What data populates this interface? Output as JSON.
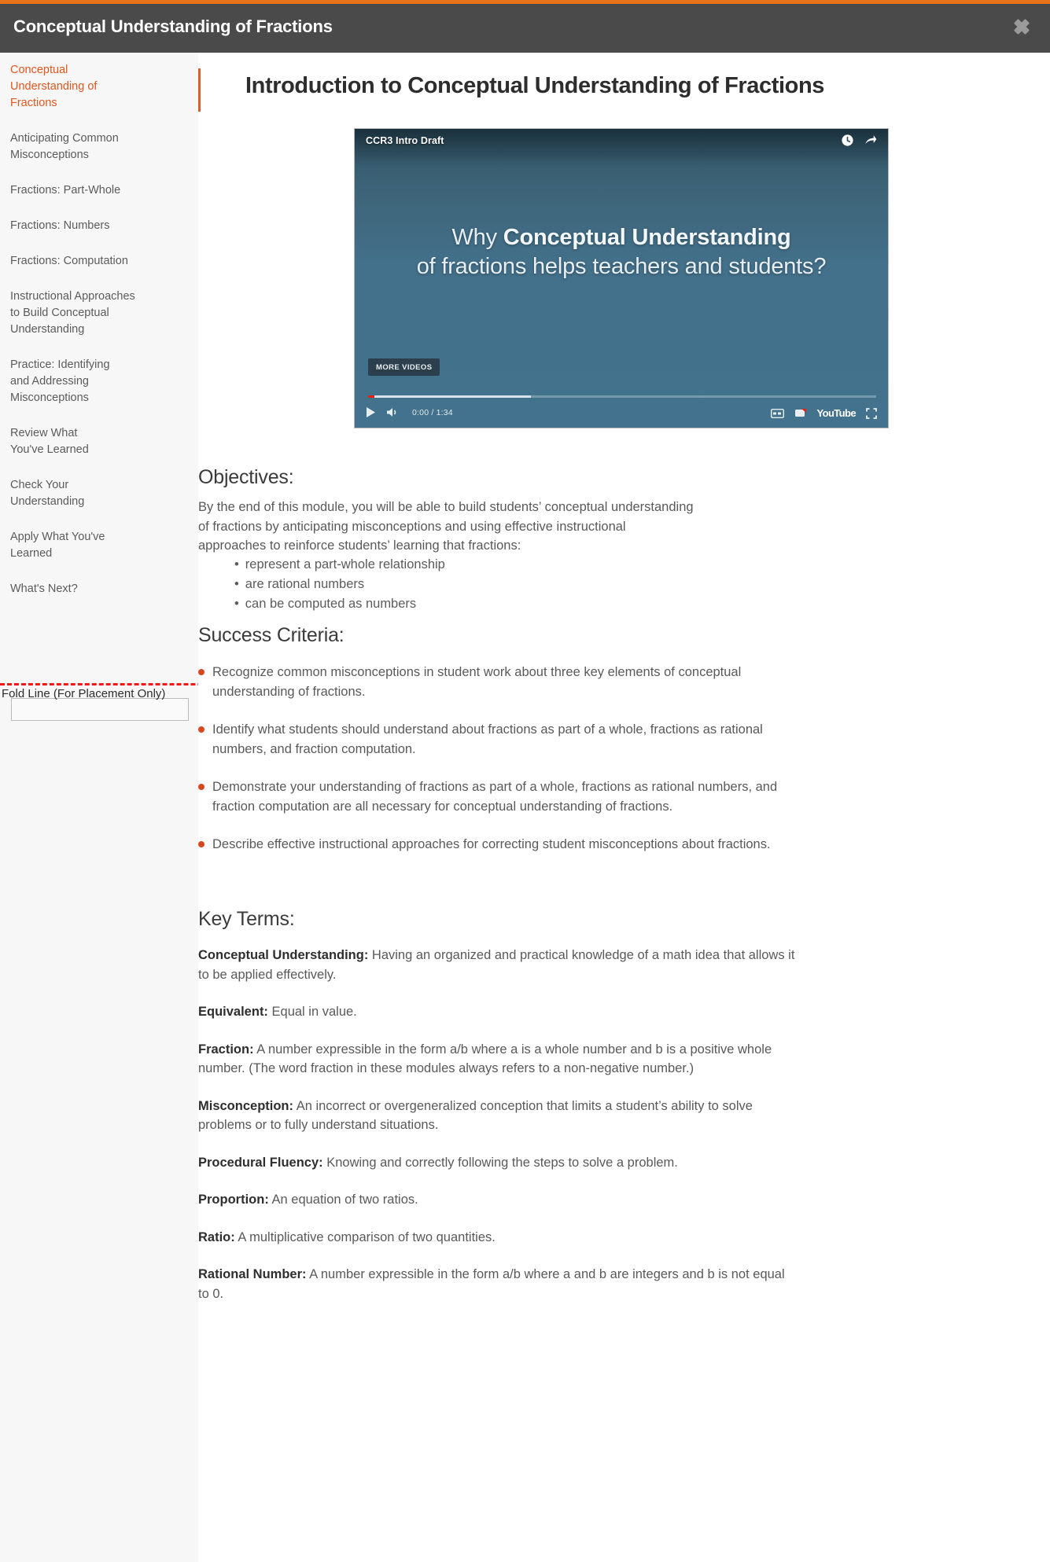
{
  "header": {
    "title": "Conceptual Understanding of Fractions",
    "close_label": "×",
    "accent_color": "#e8731d",
    "bar_color": "#4a4a4a"
  },
  "sidebar": {
    "items": [
      {
        "label": "Conceptual Understanding of Fractions",
        "active": true
      },
      {
        "label": "Anticipating Common Misconceptions",
        "active": false
      },
      {
        "label": "Fractions: Part-Whole",
        "active": false
      },
      {
        "label": "Fractions: Numbers",
        "active": false
      },
      {
        "label": "Fractions: Computation",
        "active": false
      },
      {
        "label": "Instructional Approaches to Build Conceptual Understanding",
        "active": false
      },
      {
        "label": "Practice: Identifying and Addressing Misconceptions",
        "active": false
      },
      {
        "label": "Review What You've Learned",
        "active": false
      },
      {
        "label": "Check Your Understanding",
        "active": false
      },
      {
        "label": "Apply What You've Learned",
        "active": false
      },
      {
        "label": "What's Next?",
        "active": false
      }
    ],
    "input_value": "",
    "input_placeholder": "",
    "active_color": "#e2561f"
  },
  "fold": {
    "label": "Fold Line (For Placement Only)",
    "color": "#f01818"
  },
  "main": {
    "page_title": "Introduction to Conceptual Understanding of Fractions",
    "video": {
      "name": "CCR3 Intro Draft",
      "headline_pre": "Why ",
      "headline_bold": "Conceptual Understanding",
      "headline_rest": "of fractions helps teachers and students?",
      "more_videos_label": "MORE VIDEOS",
      "current_time": "0:00",
      "duration": "1:34",
      "time_display": "0:00 / 1:34",
      "brand": "YouTube",
      "icons": {
        "watch_later": "clock-icon",
        "share": "share-icon",
        "play": "play-icon",
        "volume": "volume-icon",
        "captions": "captions-icon",
        "settings": "settings-icon",
        "fullscreen": "fullscreen-icon"
      }
    },
    "objectives": {
      "heading": "Objectives:",
      "intro": "By the end of this module, you will be able to build students’ conceptual understanding of fractions by anticipating misconceptions and using effective instructional approaches to reinforce students’ learning that fractions:",
      "bullets": [
        "represent a part-whole relationship",
        "are rational numbers",
        "can be computed as numbers"
      ]
    },
    "success_criteria": {
      "heading": "Success Criteria:",
      "items": [
        "Recognize common misconceptions in student work about three key elements of conceptual understanding of fractions.",
        "Identify what students should understand about fractions as part of a whole, fractions as rational numbers, and fraction computation.",
        "Demonstrate your understanding of fractions as part of a whole, fractions as rational numbers, and fraction computation are all necessary for conceptual understanding of fractions.",
        "Describe effective instructional approaches for correcting student misconceptions about fractions."
      ],
      "bullet_color": "#d8481f"
    },
    "key_terms": {
      "heading": "Key Terms:",
      "terms": [
        {
          "term": "Conceptual Understanding:",
          "definition": " Having an organized and practical knowledge of a math idea that allows it to be applied effectively."
        },
        {
          "term": "Equivalent:",
          "definition": " Equal in value."
        },
        {
          "term": "Fraction:",
          "definition": "  A number expressible in the form a/b where a is a whole number and b is a positive whole number. (The word fraction in these modules always refers to a non-negative number.)"
        },
        {
          "term": "Misconception:",
          "definition": " An incorrect or overgeneralized conception that limits a student’s ability to solve problems or to fully understand situations."
        },
        {
          "term": "Procedural Fluency:",
          "definition": " Knowing and correctly following the steps to solve a problem."
        },
        {
          "term": "Proportion:",
          "definition": " An equation of two ratios."
        },
        {
          "term": "Ratio:",
          "definition": " A multiplicative comparison of two quantities."
        },
        {
          "term": "Rational Number:",
          "definition": " A number expressible in the form a/b where a and b are integers and b is not equal to 0."
        }
      ]
    }
  }
}
